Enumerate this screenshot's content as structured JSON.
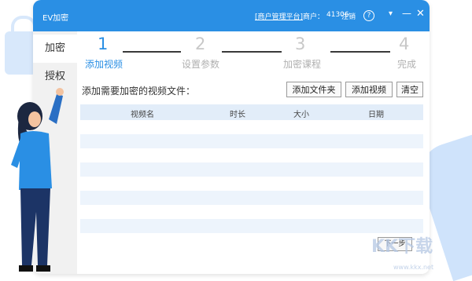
{
  "window": {
    "title": "EV加密",
    "merchant_link": "[商户管理平台]",
    "merchant_label": "商户：",
    "merchant_id": "41306",
    "logout": "注销",
    "help_glyph": "?",
    "menu_glyph": "▾",
    "min_glyph": "—",
    "close_glyph": "✕"
  },
  "sidebar": {
    "items": [
      {
        "label": "加密",
        "active": true
      },
      {
        "label": "授权",
        "active": false
      }
    ]
  },
  "steps": [
    {
      "num": "1",
      "label": "添加视频",
      "active": true
    },
    {
      "num": "2",
      "label": "设置参数",
      "active": false
    },
    {
      "num": "3",
      "label": "加密课程",
      "active": false
    },
    {
      "num": "4",
      "label": "完成",
      "active": false
    }
  ],
  "main": {
    "prompt": "添加需要加密的视频文件：",
    "buttons": {
      "add_folder": "添加文件夹",
      "add_video": "添加视频",
      "clear": "清空"
    },
    "table": {
      "columns": [
        "视频名",
        "时长",
        "大小",
        "日期"
      ],
      "rows": []
    },
    "next_button": "下一步"
  },
  "watermark": {
    "logo_text": "KK下载",
    "url": "www.kkx.net"
  },
  "colors": {
    "accent": "#2a8fe4",
    "titlebar": "#2a8fe4",
    "table_header": "#e2edf9",
    "table_alt_row": "#edf4fc"
  }
}
